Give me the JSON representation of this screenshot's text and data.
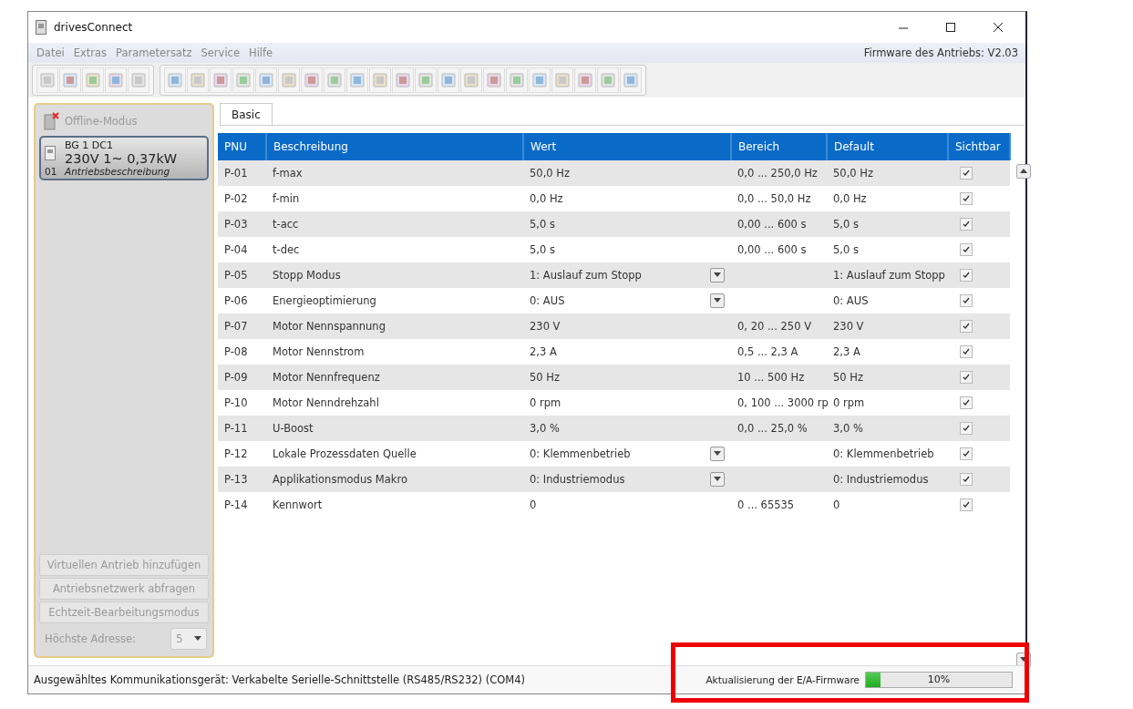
{
  "window": {
    "title": "drivesConnect"
  },
  "menu": [
    "Datei",
    "Extras",
    "Parametersatz",
    "Service",
    "Hilfe"
  ],
  "firmware": "Firmware des Antriebs: V2.03",
  "sidebar": {
    "mode": {
      "label": "Offline-Modus",
      "disabled": true
    },
    "drives": [
      {
        "line1": "BG 1  DC1",
        "line2": "230V 1~  0,37kW",
        "address": "01",
        "description": "Antriebsbeschreibung",
        "selected": true
      }
    ],
    "buttons": [
      {
        "label": "Virtuellen Antrieb hinzufügen",
        "disabled": true
      },
      {
        "label": "Antriebsnetzwerk abfragen",
        "disabled": true
      },
      {
        "label": "Echtzeit-Bearbeitungsmodus",
        "disabled": true
      }
    ],
    "address": {
      "label": "Höchste Adresse:",
      "value": "5",
      "disabled": true
    }
  },
  "tabs": [
    {
      "label": "Basic",
      "selected": true
    }
  ],
  "table": {
    "columns": [
      "PNU",
      "Beschreibung",
      "Wert",
      "Bereich",
      "Default",
      "Sichtbar"
    ],
    "rows": [
      {
        "pnu": "P-01",
        "description": "f-max",
        "value": "50,0 Hz",
        "kind": "text",
        "range": "0,0 ... 250,0 Hz",
        "default": "50,0 Hz",
        "visible": true
      },
      {
        "pnu": "P-02",
        "description": "f-min",
        "value": "0,0 Hz",
        "kind": "text",
        "range": "0,0 ... 50,0 Hz",
        "default": "0,0 Hz",
        "visible": true
      },
      {
        "pnu": "P-03",
        "description": "t-acc",
        "value": "5,0 s",
        "kind": "text",
        "range": "0,00 ... 600 s",
        "default": "5,0 s",
        "visible": true
      },
      {
        "pnu": "P-04",
        "description": "t-dec",
        "value": "5,0 s",
        "kind": "text",
        "range": "0,00 ... 600 s",
        "default": "5,0 s",
        "visible": true
      },
      {
        "pnu": "P-05",
        "description": "Stopp Modus",
        "value": "1: Auslauf zum Stopp",
        "kind": "select",
        "range": "",
        "default": "1: Auslauf zum Stopp",
        "visible": true
      },
      {
        "pnu": "P-06",
        "description": "Energieoptimierung",
        "value": "0: AUS",
        "kind": "select",
        "range": "",
        "default": "0: AUS",
        "visible": true
      },
      {
        "pnu": "P-07",
        "description": "Motor Nennspannung",
        "value": "230 V",
        "kind": "text",
        "range": "0, 20 ... 250 V",
        "default": "230 V",
        "visible": true
      },
      {
        "pnu": "P-08",
        "description": "Motor Nennstrom",
        "value": "2,3 A",
        "kind": "text",
        "range": "0,5 ... 2,3 A",
        "default": "2,3 A",
        "visible": true
      },
      {
        "pnu": "P-09",
        "description": "Motor Nennfrequenz",
        "value": "50 Hz",
        "kind": "text",
        "range": "10 ... 500 Hz",
        "default": "50 Hz",
        "visible": true
      },
      {
        "pnu": "P-10",
        "description": "Motor Nenndrehzahl",
        "value": "0 rpm",
        "kind": "text",
        "range": "0, 100 ... 3000 rp",
        "default": "0 rpm",
        "visible": true
      },
      {
        "pnu": "P-11",
        "description": "U-Boost",
        "value": "3,0 %",
        "kind": "text",
        "range": "0,0 ... 25,0 %",
        "default": "3,0 %",
        "visible": true
      },
      {
        "pnu": "P-12",
        "description": "Lokale Prozessdaten Quelle",
        "value": "0: Klemmenbetrieb",
        "kind": "select",
        "range": "",
        "default": "0: Klemmenbetrieb",
        "visible": true
      },
      {
        "pnu": "P-13",
        "description": "Applikationsmodus Makro",
        "value": "0: Industriemodus",
        "kind": "select",
        "range": "",
        "default": "0: Industriemodus",
        "visible": true
      },
      {
        "pnu": "P-14",
        "description": "Kennwort",
        "value": "0",
        "kind": "text",
        "range": "0 ... 65535",
        "default": "0",
        "visible": true
      }
    ]
  },
  "status_bar": {
    "device": "Ausgewähltes Kommunikationsgerät: Verkabelte Serielle-Schnittstelle (RS485/RS232) (COM4)",
    "progress": {
      "label": "Aktualisierung der E/A-Firmware",
      "level": 0.1,
      "reading": "10%"
    }
  }
}
